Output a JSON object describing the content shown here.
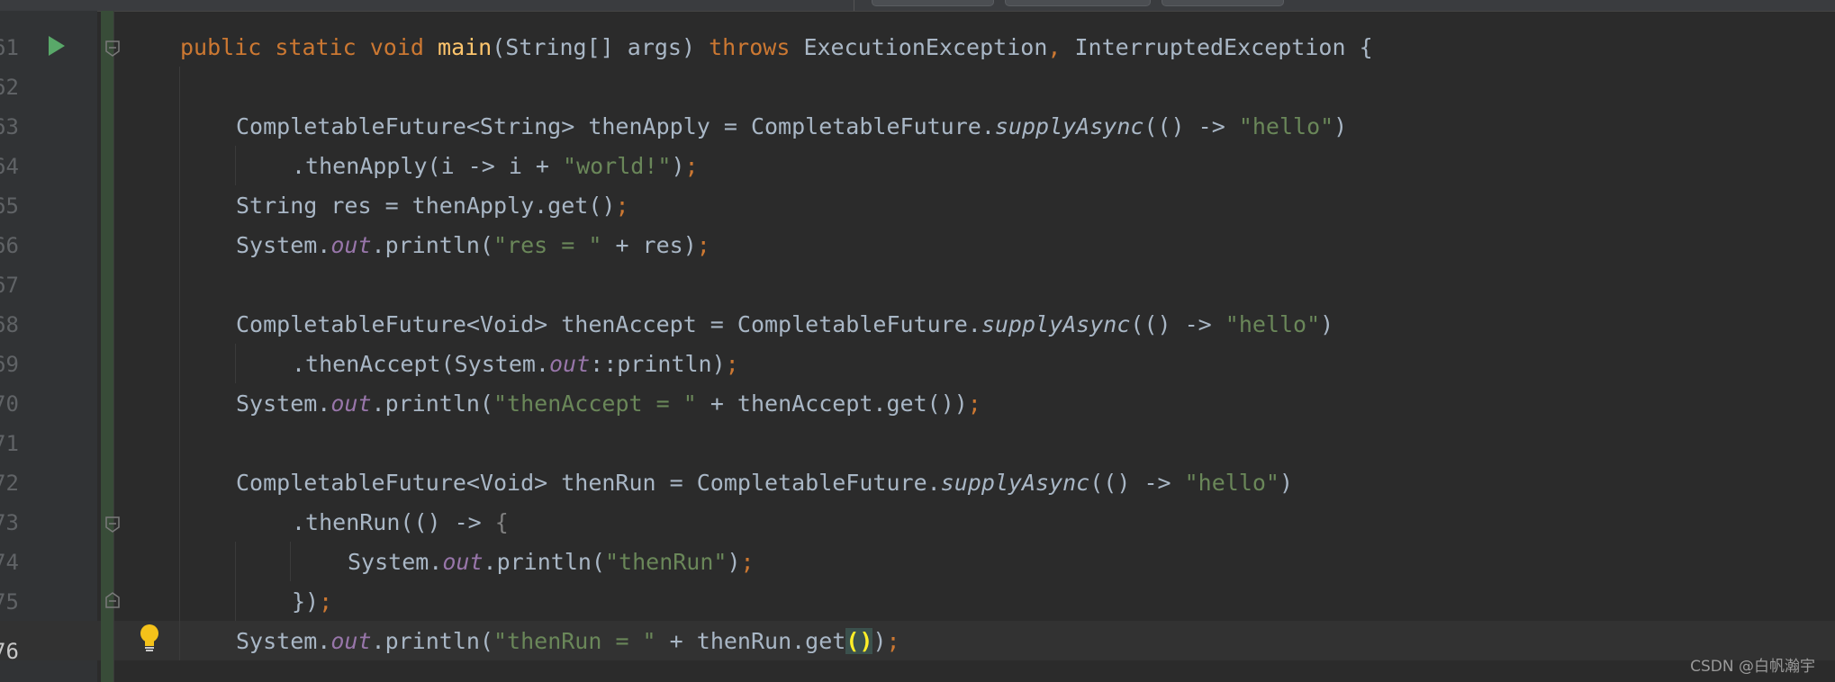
{
  "editor": {
    "line_numbers": [
      "61",
      "62",
      "63",
      "64",
      "65",
      "66",
      "67",
      "68",
      "69",
      "70",
      "71",
      "72",
      "73",
      "74",
      "75",
      "76"
    ],
    "active_line": "76",
    "colors": {
      "background": "#2b2b2b",
      "keyword": "#cc7832",
      "method_decl": "#ffc66d",
      "string": "#6a8759",
      "static_field": "#9876aa",
      "default_text": "#a9b7c6",
      "run_gutter": "#59a869"
    },
    "icons": [
      "run-icon",
      "fold-icon",
      "intention-bulb-icon"
    ],
    "code": {
      "l61": {
        "kw1": "public",
        "kw2": "static",
        "kw3": "void",
        "method": "main",
        "params": "(String[] args) ",
        "kw4": "throws",
        "exc1": " ExecutionException",
        "comma": ",",
        "exc2": " InterruptedException {"
      },
      "l63": {
        "a": "CompletableFuture<String> thenApply = CompletableFuture.",
        "b": "supplyAsync",
        "c": "(() -> ",
        "s": "\"hello\"",
        "d": ")"
      },
      "l64": {
        "a": ".thenApply(i -> i + ",
        "s": "\"world!\"",
        "d": ")",
        "semi": ";"
      },
      "l65": {
        "a": "String res = thenApply.get()",
        "semi": ";"
      },
      "l66": {
        "a": "System.",
        "f": "out",
        "b": ".println(",
        "s": "\"res = \"",
        "c": " + res)",
        "semi": ";"
      },
      "l68": {
        "a": "CompletableFuture<Void> thenAccept = CompletableFuture.",
        "b": "supplyAsync",
        "c": "(() -> ",
        "s": "\"hello\"",
        "d": ")"
      },
      "l69": {
        "a": ".thenAccept(System.",
        "f": "out",
        "b": "::println)",
        "semi": ";"
      },
      "l70": {
        "a": "System.",
        "f": "out",
        "b": ".println(",
        "s": "\"thenAccept = \"",
        "c": " + thenAccept.get())",
        "semi": ";"
      },
      "l72": {
        "a": "CompletableFuture<Void> thenRun = CompletableFuture.",
        "b": "supplyAsync",
        "c": "(() -> ",
        "s": "\"hello\"",
        "d": ")"
      },
      "l73": {
        "a": ".thenRun(() -> ",
        "brace": "{"
      },
      "l74": {
        "a": "System.",
        "f": "out",
        "b": ".println(",
        "s": "\"thenRun\"",
        "c": ")",
        "semi": ";"
      },
      "l75": {
        "a": "})",
        "semi": ";"
      },
      "l76": {
        "a": "System.",
        "f": "out",
        "b": ".println(",
        "s": "\"thenRun = \"",
        "c": " + thenRun.get",
        "paren": "()",
        "d": ")",
        "semi": ";"
      }
    }
  },
  "watermark": "CSDN @白帆瀚宇"
}
